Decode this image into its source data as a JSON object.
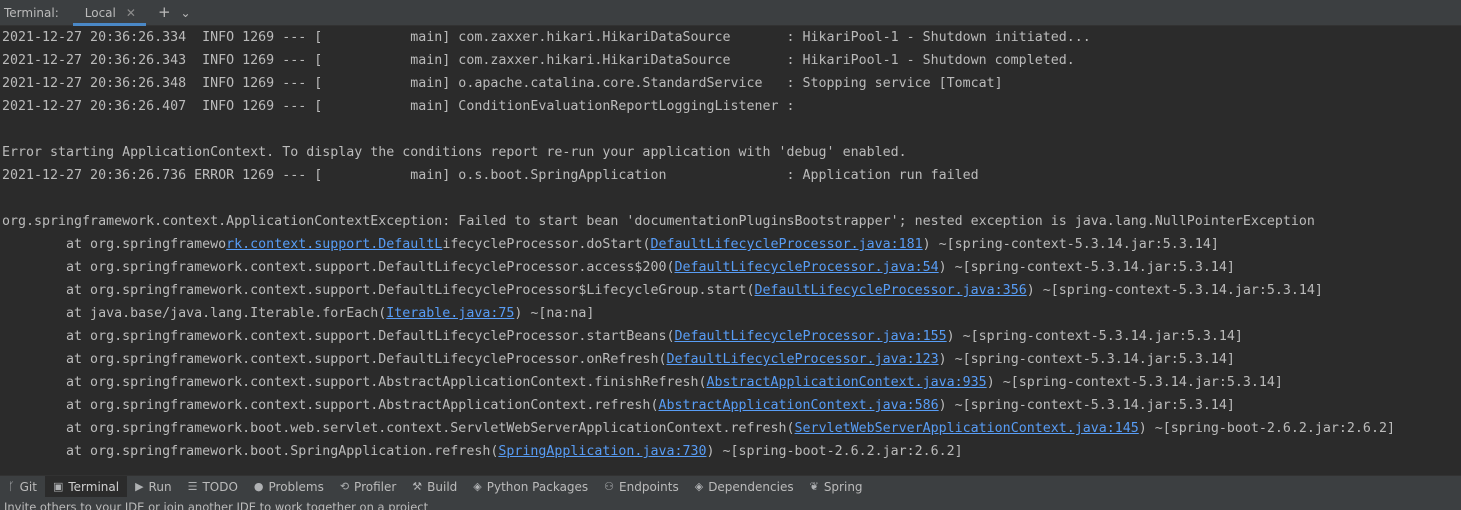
{
  "tabbar": {
    "label": "Terminal:",
    "tab": "Local",
    "close_glyph": "✕",
    "add_glyph": "+",
    "menu_glyph": "⌄"
  },
  "console": {
    "lines": [
      [
        "2021-12-27 20:36:26.334  INFO 1269 --- [           main] com.zaxxer.hikari.HikariDataSource       : HikariPool-1 - Shutdown initiated..."
      ],
      [
        "2021-12-27 20:36:26.343  INFO 1269 --- [           main] com.zaxxer.hikari.HikariDataSource       : HikariPool-1 - Shutdown completed."
      ],
      [
        "2021-12-27 20:36:26.348  INFO 1269 --- [           main] o.apache.catalina.core.StandardService   : Stopping service [Tomcat]"
      ],
      [
        "2021-12-27 20:36:26.407  INFO 1269 --- [           main] ConditionEvaluationReportLoggingListener : "
      ],
      [
        ""
      ],
      [
        "Error starting ApplicationContext. To display the conditions report re-run your application with 'debug' enabled."
      ],
      [
        "2021-12-27 20:36:26.736 ERROR 1269 --- [           main] o.s.boot.SpringApplication               : Application run failed"
      ],
      [
        ""
      ],
      [
        "org.springframework.context.ApplicationContextException: Failed to start bean 'documentationPluginsBootstrapper'; nested exception is java.lang.NullPointerException"
      ],
      [
        "        at org.springframewo",
        {
          "link": "rk.context.support.DefaultL"
        },
        "ifecycleProcessor.doStart(",
        {
          "link": "DefaultLifecycleProcessor.java:181"
        },
        ") ~[spring-context-5.3.14.jar:5.3.14]"
      ],
      [
        "        at org.springframework.context.support.DefaultLifecycleProcessor.access$200(",
        {
          "link": "DefaultLifecycleProcessor.java:54"
        },
        ") ~[spring-context-5.3.14.jar:5.3.14]"
      ],
      [
        "        at org.springframework.context.support.DefaultLifecycleProcessor$LifecycleGroup.start(",
        {
          "link": "DefaultLifecycleProcessor.java:356"
        },
        ") ~[spring-context-5.3.14.jar:5.3.14]"
      ],
      [
        "        at java.base/java.lang.Iterable.forEach(",
        {
          "link": "Iterable.java:75"
        },
        ") ~[na:na]"
      ],
      [
        "        at org.springframework.context.support.DefaultLifecycleProcessor.startBeans(",
        {
          "link": "DefaultLifecycleProcessor.java:155"
        },
        ") ~[spring-context-5.3.14.jar:5.3.14]"
      ],
      [
        "        at org.springframework.context.support.DefaultLifecycleProcessor.onRefresh(",
        {
          "link": "DefaultLifecycleProcessor.java:123"
        },
        ") ~[spring-context-5.3.14.jar:5.3.14]"
      ],
      [
        "        at org.springframework.context.support.AbstractApplicationContext.finishRefresh(",
        {
          "link": "AbstractApplicationContext.java:935"
        },
        ") ~[spring-context-5.3.14.jar:5.3.14]"
      ],
      [
        "        at org.springframework.context.support.AbstractApplicationContext.refresh(",
        {
          "link": "AbstractApplicationContext.java:586"
        },
        ") ~[spring-context-5.3.14.jar:5.3.14]"
      ],
      [
        "        at org.springframework.boot.web.servlet.context.ServletWebServerApplicationContext.refresh(",
        {
          "link": "ServletWebServerApplicationContext.java:145"
        },
        ") ~[spring-boot-2.6.2.jar:2.6.2]"
      ],
      [
        "        at org.springframework.boot.SpringApplication.refresh(",
        {
          "link": "SpringApplication.java:730"
        },
        ") ~[spring-boot-2.6.2.jar:2.6.2]"
      ]
    ]
  },
  "toolwindows": [
    {
      "id": "git",
      "label": "Git",
      "icon": "ᚴ",
      "icon_name": "git-branch-icon",
      "active": false
    },
    {
      "id": "terminal",
      "label": "Terminal",
      "icon": "▣",
      "icon_name": "terminal-icon",
      "active": true
    },
    {
      "id": "run",
      "label": "Run",
      "icon": "▶",
      "icon_name": "run-icon",
      "active": false
    },
    {
      "id": "todo",
      "label": "TODO",
      "icon": "☰",
      "icon_name": "todo-list-icon",
      "active": false
    },
    {
      "id": "problems",
      "label": "Problems",
      "icon": "●",
      "icon_name": "problems-icon",
      "active": false
    },
    {
      "id": "profiler",
      "label": "Profiler",
      "icon": "⟲",
      "icon_name": "profiler-icon",
      "active": false
    },
    {
      "id": "build",
      "label": "Build",
      "icon": "⚒",
      "icon_name": "build-hammer-icon",
      "active": false
    },
    {
      "id": "python-packages",
      "label": "Python Packages",
      "icon": "◈",
      "icon_name": "layers-icon",
      "active": false
    },
    {
      "id": "endpoints",
      "label": "Endpoints",
      "icon": "⚇",
      "icon_name": "endpoints-icon",
      "active": false
    },
    {
      "id": "dependencies",
      "label": "Dependencies",
      "icon": "◈",
      "icon_name": "layers-icon",
      "active": false
    },
    {
      "id": "spring",
      "label": "Spring",
      "icon": "❦",
      "icon_name": "spring-leaf-icon",
      "active": false
    }
  ],
  "statusbar": {
    "message": "Invite others to your IDE or join another IDE to work together on a project"
  },
  "colors": {
    "background": "#2b2b2b",
    "panel": "#3c3f41",
    "text": "#bbbbbb",
    "link": "#589df6",
    "accent": "#4a88c7"
  }
}
